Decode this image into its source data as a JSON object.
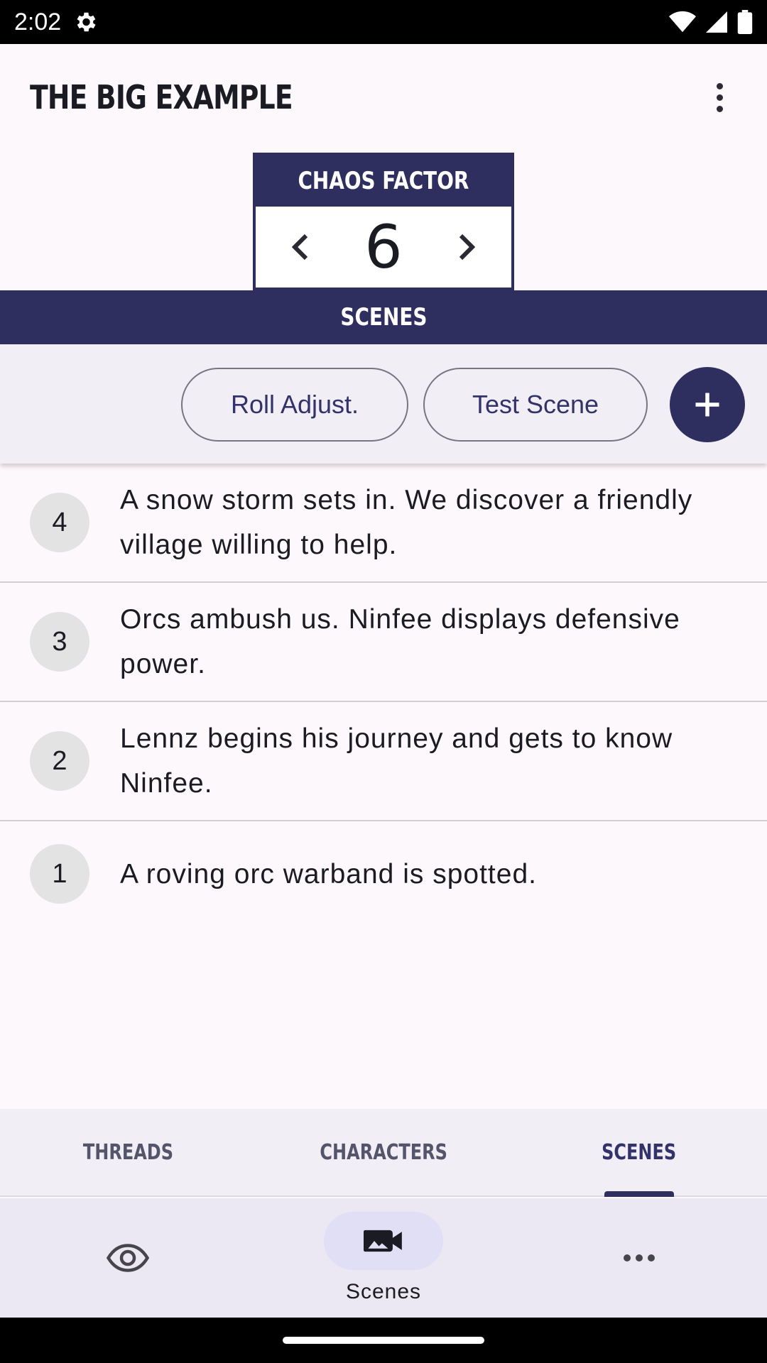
{
  "status_bar": {
    "time": "2:02"
  },
  "app": {
    "title": "THE BIG EXAMPLE"
  },
  "chaos_factor": {
    "label": "CHAOS FACTOR",
    "value": "6"
  },
  "section": {
    "title": "SCENES"
  },
  "actions": {
    "roll_adjust_label": "Roll Adjust.",
    "test_scene_label": "Test Scene"
  },
  "scenes": [
    {
      "number": "4",
      "text": "A snow storm sets in. We discover a friendly village willing to help."
    },
    {
      "number": "3",
      "text": "Orcs ambush us. Ninfee displays defensive power."
    },
    {
      "number": "2",
      "text": "Lennz begins his journey and gets to know Ninfee."
    },
    {
      "number": "1",
      "text": "A roving orc warband is spotted."
    }
  ],
  "top_tabs": [
    {
      "label": "THREADS"
    },
    {
      "label": "CHARACTERS"
    },
    {
      "label": "SCENES",
      "active": true
    }
  ],
  "bottom_nav": [
    {
      "icon": "eye-icon",
      "label": ""
    },
    {
      "icon": "video-camera-icon",
      "label": "Scenes",
      "active": true
    },
    {
      "icon": "more-horiz-icon",
      "label": ""
    }
  ],
  "colors": {
    "primary": "#2f2f5f",
    "surface": "#fdf8fc",
    "surface_variant": "#f1eef6",
    "nav_active": "#e1dff6"
  }
}
